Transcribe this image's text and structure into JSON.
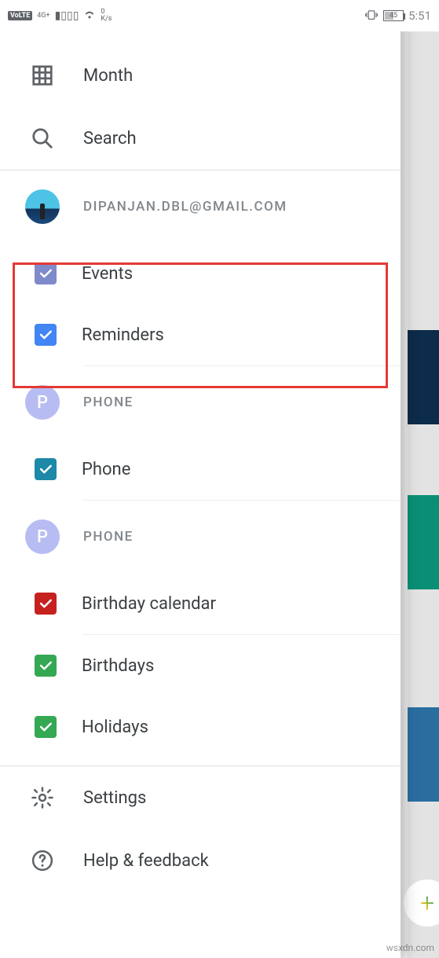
{
  "status": {
    "volte": "VoLTE",
    "net": "4G+",
    "speed_top": "0",
    "speed_unit": "K/s",
    "battery_pct": "45",
    "time": "5:51",
    "vibrate_icon": "vibrate",
    "wifi_icon": "wifi"
  },
  "nav": {
    "month": "Month",
    "search": "Search",
    "settings": "Settings",
    "help": "Help & feedback"
  },
  "accounts": [
    {
      "email": "DIPANJAN.DBL@GMAIL.COM",
      "avatar_type": "photo",
      "calendars": [
        {
          "label": "Events",
          "color": "#7f8acb",
          "checked": true
        },
        {
          "label": "Reminders",
          "color": "#4285f4",
          "checked": true
        }
      ]
    },
    {
      "email": "PHONE",
      "avatar_type": "letter",
      "avatar_letter": "P",
      "calendars": [
        {
          "label": "Phone",
          "color": "#1e88a8",
          "checked": true
        }
      ]
    },
    {
      "email": "PHONE",
      "avatar_type": "letter",
      "avatar_letter": "P",
      "calendars": [
        {
          "label": "Birthday calendar",
          "color": "#c5221f",
          "checked": true
        },
        {
          "label": "Birthdays",
          "color": "#34a853",
          "checked": true
        },
        {
          "label": "Holidays",
          "color": "#34a853",
          "checked": true
        }
      ]
    }
  ],
  "watermark": "wsxdn.com"
}
